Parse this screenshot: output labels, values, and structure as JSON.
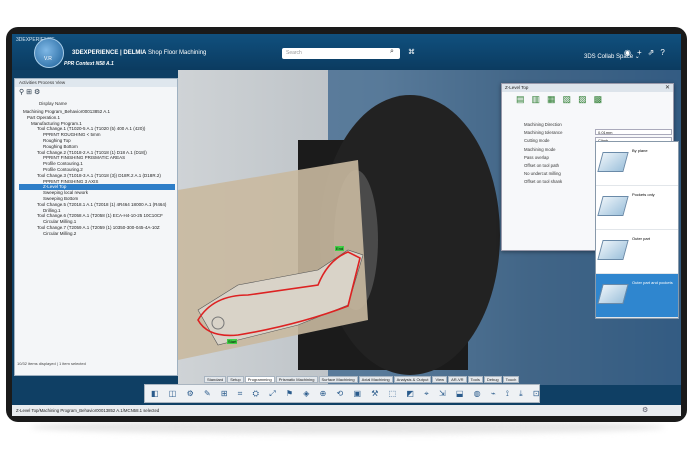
{
  "app": {
    "brand_small": "3DEXPERIENCE",
    "compass_label": "V.R",
    "title_brand": "3DEXPERIENCE | DELMIA",
    "title_app": "Shop Floor Machining",
    "search_placeholder": "Search",
    "space": "3DS Collab Space ⌄",
    "doc_tab": "PPR Context N58 A.1"
  },
  "panel": {
    "title": "Activities Process View",
    "display_name": "Display Name",
    "status": "10/32 items displayed | 1 item selected",
    "tree": [
      {
        "indent": 4,
        "label": "Machining Program_Behavior00013852 A.1",
        "selected": false
      },
      {
        "indent": 8,
        "label": "Part Operation.1",
        "selected": false
      },
      {
        "indent": 12,
        "label": "Manufacturing Program.1",
        "selected": false
      },
      {
        "indent": 18,
        "label": "Tool Change.1 (T1020-5 A.1 (T1020 (5) 400 A.1 (420))",
        "selected": false
      },
      {
        "indent": 24,
        "label": "PPRINT ROUGHING < 5mm",
        "selected": false
      },
      {
        "indent": 24,
        "label": "Roughing Top",
        "selected": false
      },
      {
        "indent": 24,
        "label": "Roughing Bottom",
        "selected": false
      },
      {
        "indent": 18,
        "label": "Tool Change.2 (T1018-2 A.1 (T1018 (1) D18 A.1 (D18))",
        "selected": false
      },
      {
        "indent": 24,
        "label": "PPRINT FINISHING PRISMATIC AREAS",
        "selected": false
      },
      {
        "indent": 24,
        "label": "Profile Contouring.1",
        "selected": false
      },
      {
        "indent": 24,
        "label": "Profile Contouring.2",
        "selected": false
      },
      {
        "indent": 18,
        "label": "Tool Change.3 (T1018-3 A.1 (T1018 (3)) D18R.2 A.1 (D18R.2)",
        "selected": false
      },
      {
        "indent": 24,
        "label": "PPRINT FINISHING 3 AXIS",
        "selected": false
      },
      {
        "indent": 24,
        "label": "Z-Level Top",
        "selected": true
      },
      {
        "indent": 24,
        "label": "Sweeping local rework",
        "selected": false
      },
      {
        "indent": 24,
        "label": "Sweeping Bottom",
        "selected": false
      },
      {
        "indent": 18,
        "label": "Tool Change.5 (T2018.1 A.1 (T2018 (1) 4R464 18000 A.1 (R464)",
        "selected": false
      },
      {
        "indent": 24,
        "label": "Drilling.1",
        "selected": false
      },
      {
        "indent": 18,
        "label": "Tool Change.6 (T2058 A.1 (T2058 (1) ECA-H4-10-25 10C10CF",
        "selected": false
      },
      {
        "indent": 24,
        "label": "Circular Milling.1",
        "selected": false
      },
      {
        "indent": 18,
        "label": "Tool Change.7 (T2059 A.1 (T2059 (1) 10350-300-045-4A-10Z",
        "selected": false
      },
      {
        "indent": 24,
        "label": "Circular Milling.2",
        "selected": false
      }
    ]
  },
  "dialog": {
    "title": "Z-Level Top",
    "close": "✕",
    "rows": [
      {
        "label": "Machining Direction",
        "value": ""
      },
      {
        "label": "Machining tolerance",
        "value": "0.01mm"
      },
      {
        "label": "Cutting mode",
        "value": "Climb"
      },
      {
        "label": "Machining mode",
        "value": "Outer part and pockets"
      },
      {
        "label": "Pass overlap",
        "value": ""
      },
      {
        "label": "Offset on tool path",
        "value": ""
      },
      {
        "label": "No undercut milling",
        "value": ""
      },
      {
        "label": "Offset on tool shank",
        "value": ""
      }
    ]
  },
  "dropdown": [
    {
      "label": "By plane",
      "selected": false
    },
    {
      "label": "Pockets only",
      "selected": false
    },
    {
      "label": "Outer part",
      "selected": false
    },
    {
      "label": "Outer part and pockets",
      "selected": true
    }
  ],
  "bottom_tabs": [
    {
      "label": "Standard",
      "active": false
    },
    {
      "label": "Setup",
      "active": false
    },
    {
      "label": "Programming",
      "active": true
    },
    {
      "label": "Prismatic Machining",
      "active": false
    },
    {
      "label": "Surface Machining",
      "active": false
    },
    {
      "label": "Axial Machining",
      "active": false
    },
    {
      "label": "Analysis & Output",
      "active": false
    },
    {
      "label": "View",
      "active": false
    },
    {
      "label": "AR-VR",
      "active": false
    },
    {
      "label": "Tools",
      "active": false
    },
    {
      "label": "Debug",
      "active": false
    },
    {
      "label": "Touch",
      "active": false
    }
  ],
  "toolbar_glyphs": "◧ ◫ ⚙ ✎ ⊞ ⌗ ⛭ ⤢ ⚑ ◈ ⊕ ⟲ ▣ ⚒ ⬚ ◩ ⌖ ⇲ ⬓ ◍ ⌁ ⟟ ⤓ ⊡",
  "status_bar": "Z-Level Top/Machining Program_Behavior00013852 A.1/MCN58.1 selected",
  "viewport_labels": {
    "start": "Start",
    "end": "End"
  }
}
